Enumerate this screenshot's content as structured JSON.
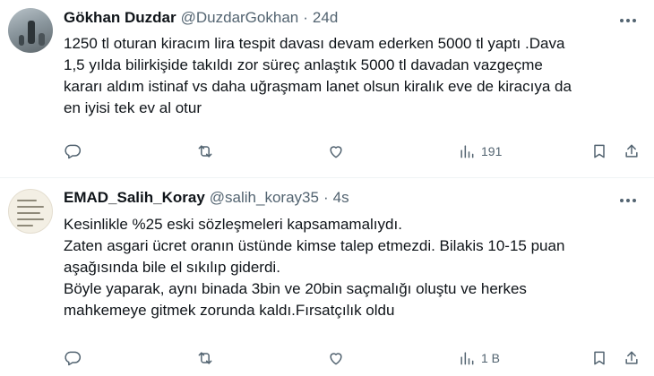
{
  "tweets": [
    {
      "name": "Gökhan Duzdar",
      "handle": "@DuzdarGokhan",
      "separator": "·",
      "time": "24d",
      "lines": [
        "1250 tl oturan kiracım lira tespit davası devam ederken 5000 tl yaptı .Dava",
        "1,5 yılda bilirkişide takıldı zor süreç anlaştık 5000 tl davadan vazgeçme",
        "kararı aldım istinaf vs daha uğraşmam lanet olsun kiralık eve de kiracıya da",
        "en iyisi tek ev al otur"
      ],
      "views": "191"
    },
    {
      "name": "EMAD_Salih_Koray",
      "handle": "@salih_koray35",
      "separator": "·",
      "time": "4s",
      "lines": [
        "Kesinlikle %25 eski sözleşmeleri kapsamamalıydı.",
        "Zaten asgari ücret oranın üstünde kimse talep etmezdi. Bilakis 10-15 puan",
        "aşağısında bile el sıkılıp giderdi.",
        "Böyle yaparak, aynı binada 3bin ve 20bin saçmalığı oluştu ve herkes",
        "mahkemeye gitmek zorunda kaldı.Fırsatçılık oldu"
      ],
      "views": "1 B"
    }
  ],
  "icons": {
    "reply": "reply-icon",
    "retweet": "retweet-icon",
    "like": "like-icon",
    "views": "views-icon",
    "bookmark": "bookmark-icon",
    "share": "share-icon",
    "more": "more-icon"
  },
  "colors": {
    "text": "#0f1419",
    "secondary": "#536471",
    "divider": "#eff3f4"
  }
}
